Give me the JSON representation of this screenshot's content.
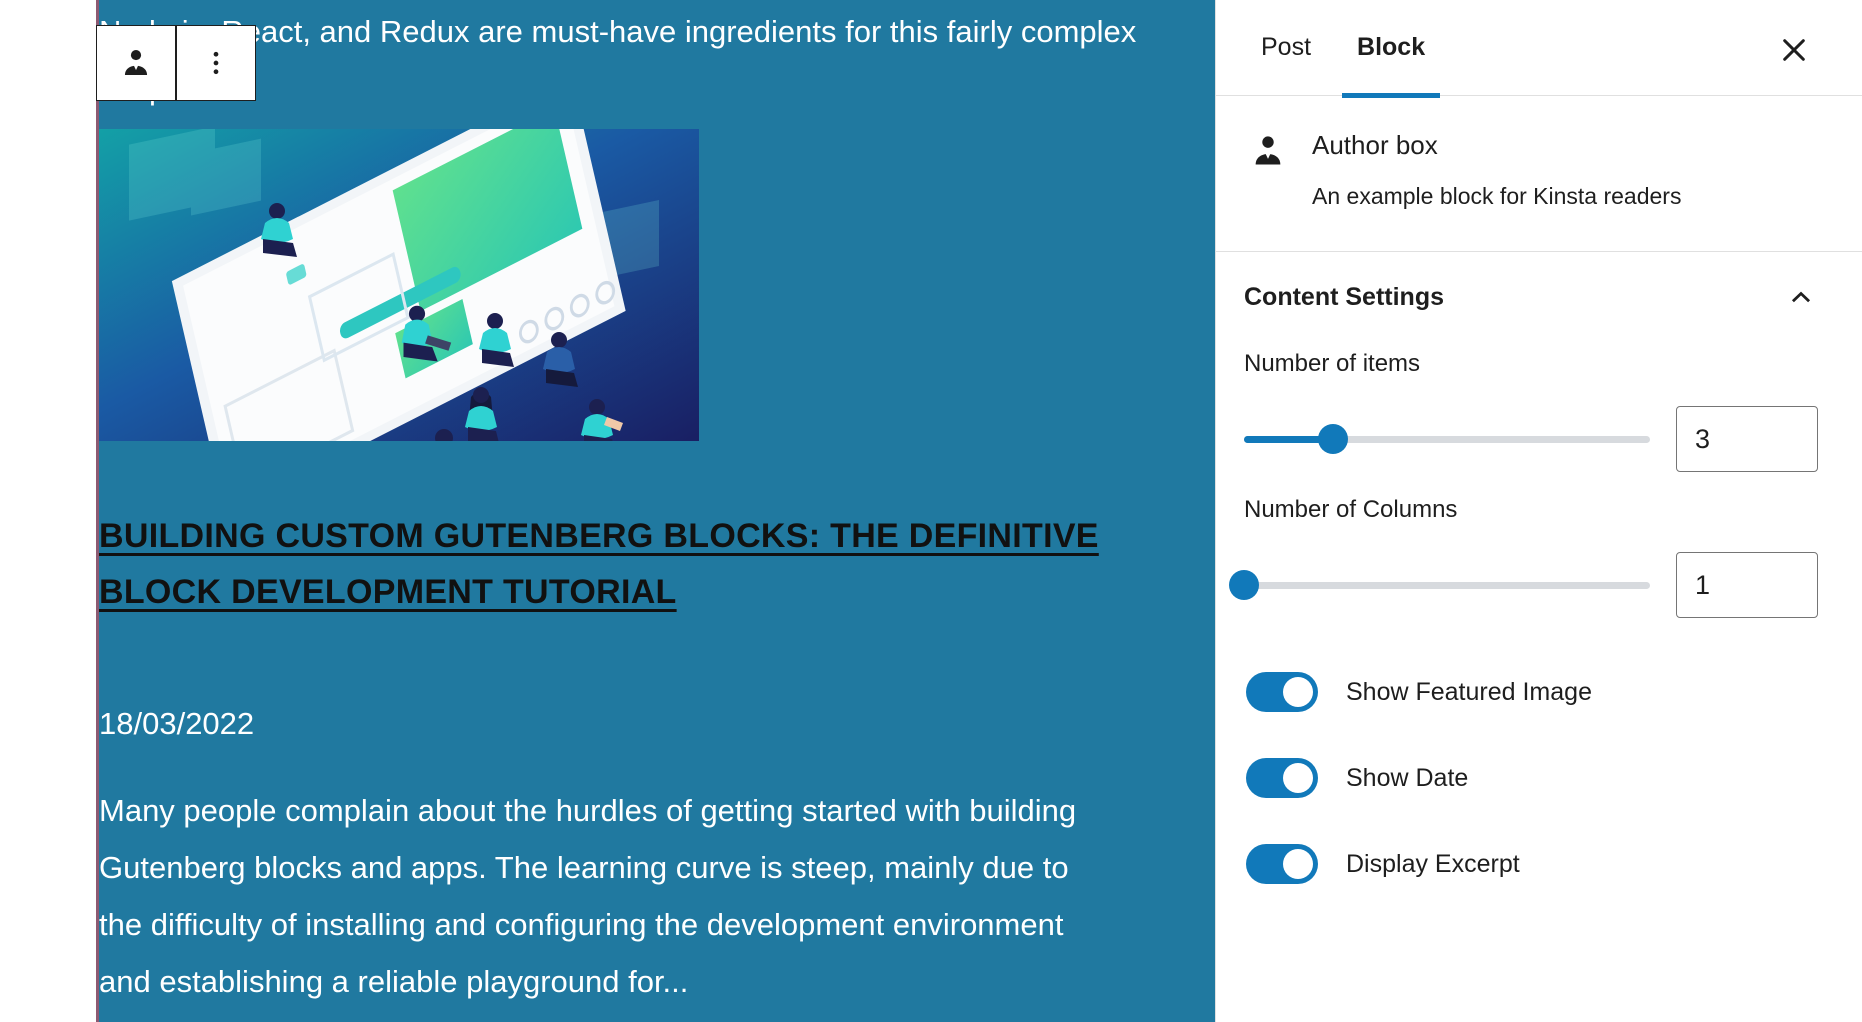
{
  "editor": {
    "paragraph_top": "development environment. In addition, a solid knowledge of JavaScript, Node.js, React, and Redux are must-have ingredients for this fairly complex recipe.",
    "featured_image_alt": "isometric-illustration-people-on-device",
    "post_heading": "Building Custom Gutenberg Blocks: The Definitive Block Development Tutorial",
    "post_date": "18/03/2022",
    "post_excerpt": "Many people complain about the hurdles of getting started with building Gutenberg blocks and apps. The learning curve is steep, mainly due to the difficulty of installing and configuring the development environment and establishing a reliable playground for...",
    "toolbar": {
      "block_icon_name": "author-box-icon",
      "options_icon_name": "more-options-icon"
    },
    "canvas_bg": "#2079a0"
  },
  "sidebar": {
    "tabs": [
      {
        "label": "Post",
        "active": false
      },
      {
        "label": "Block",
        "active": true
      }
    ],
    "close_label": "Close settings",
    "block_card": {
      "icon_name": "author-box-icon",
      "title": "Author box",
      "description": "An example block for Kinsta readers"
    },
    "panel": {
      "title": "Content Settings",
      "expanded": true,
      "fields": [
        {
          "label": "Number of items",
          "value": "3",
          "slider_percent": 22
        },
        {
          "label": "Number of Columns",
          "value": "1",
          "slider_percent": 0
        }
      ],
      "toggles": [
        {
          "label": "Show Featured Image",
          "on": true
        },
        {
          "label": "Show Date",
          "on": true
        },
        {
          "label": "Display Excerpt",
          "on": true
        }
      ]
    },
    "accent_color": "#1179ba"
  }
}
